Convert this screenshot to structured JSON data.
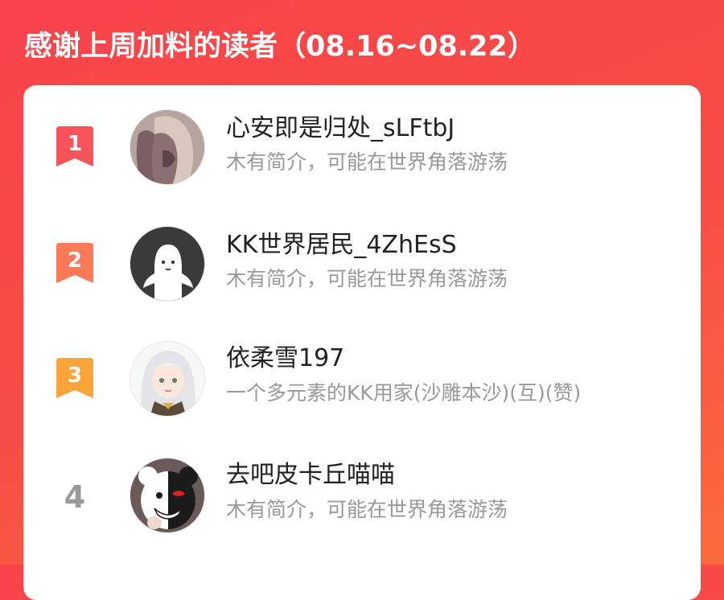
{
  "header": {
    "title": "感谢上周加料的读者（08.16~08.22）"
  },
  "colors": {
    "background": "#f8434a",
    "rank_1": "#f8535b",
    "rank_2": "#fa7a58",
    "rank_3": "#fba43a",
    "rank_other": "#9a9a9a"
  },
  "readers": [
    {
      "rank": "1",
      "name": "心安即是归处_sLFtbJ",
      "bio": "木有简介，可能在世界角落游荡",
      "avatar": "avatar-long-hair-illustration"
    },
    {
      "rank": "2",
      "name": "KK世界居民_4ZhEsS",
      "bio": "木有简介，可能在世界角落游荡",
      "avatar": "avatar-default-ghost"
    },
    {
      "rank": "3",
      "name": "依柔雪197",
      "bio": "一个多元素的KK用家(沙雕本沙)(互)(赞)",
      "avatar": "avatar-white-hair-anime-girl"
    },
    {
      "rank": "4",
      "name": "去吧皮卡丘喵喵",
      "bio": "木有简介，可能在世界角落游荡",
      "avatar": "avatar-bear-mascot"
    }
  ]
}
